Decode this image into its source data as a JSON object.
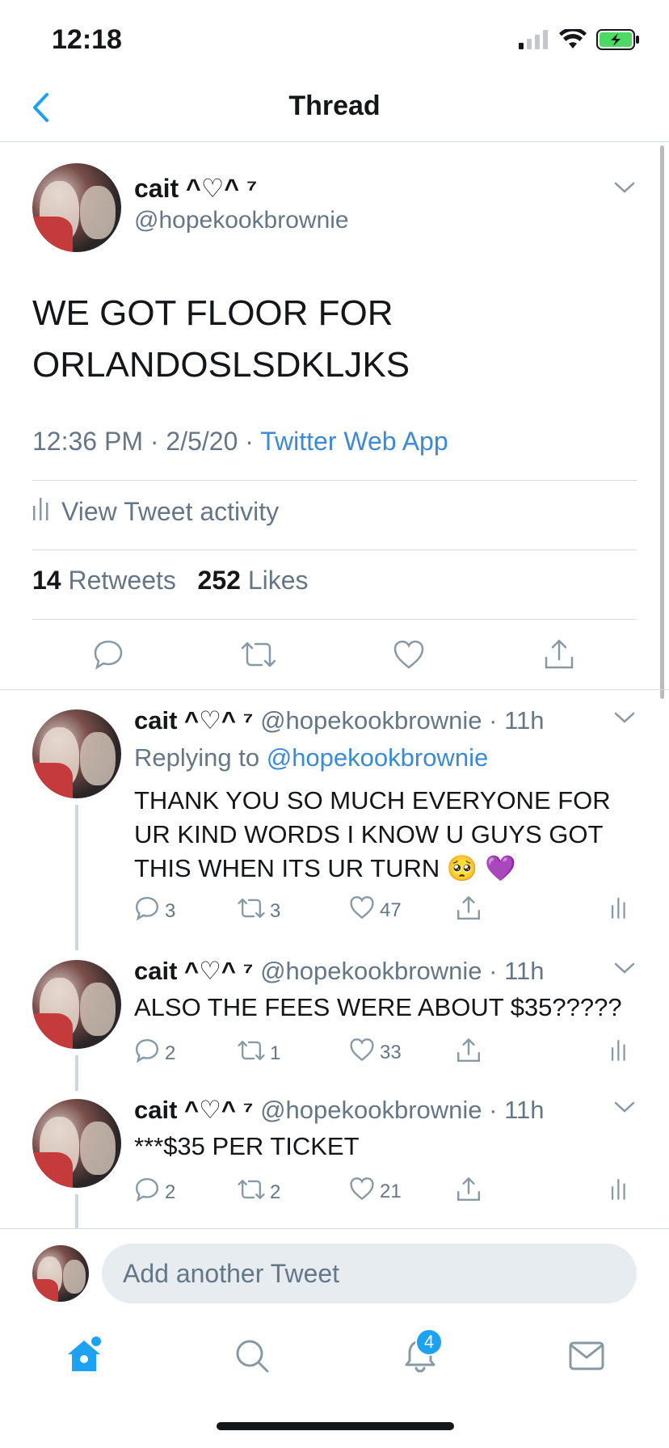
{
  "status_bar": {
    "time": "12:18"
  },
  "nav": {
    "title": "Thread"
  },
  "main_tweet": {
    "name": "cait ^♡^ ⁷",
    "handle": "@hopekookbrownie",
    "text_line1": "WE GOT FLOOR FOR",
    "text_line2": "ORLANDOSLSDKLJKS",
    "timestamp": "12:36 PM · 2/5/20 · ",
    "app": "Twitter Web App",
    "activity_label": "View Tweet activity",
    "retweets_count": "14",
    "retweets_label": "Retweets",
    "likes_count": "252",
    "likes_label": "Likes"
  },
  "replies": [
    {
      "name": "cait ^♡^ ⁷",
      "handle_time": "@hopekookbrownie · 11h",
      "replying_prefix": "Replying to ",
      "replying_to": "@hopekookbrownie",
      "text": "THANK YOU SO MUCH EVERYONE FOR UR KIND WORDS I KNOW U GUYS GOT THIS WHEN ITS UR TURN 🥺 💜",
      "replies": "3",
      "retweets": "3",
      "likes": "47"
    },
    {
      "name": "cait ^♡^ ⁷",
      "handle_time": "@hopekookbrownie · 11h",
      "text": "ALSO THE FEES WERE ABOUT $35?????",
      "replies": "2",
      "retweets": "1",
      "likes": "33"
    },
    {
      "name": "cait ^♡^ ⁷",
      "handle_time": "@hopekookbrownie · 11h",
      "text": "***$35 PER TICKET",
      "replies": "2",
      "retweets": "2",
      "likes": "21"
    }
  ],
  "compose": {
    "placeholder": "Add another Tweet"
  },
  "tab_bar": {
    "notifications_badge": "4"
  },
  "colors": {
    "accent": "#1da1f2",
    "link": "#3a8ad7",
    "muted": "#657786",
    "battery": "#4cd964"
  }
}
